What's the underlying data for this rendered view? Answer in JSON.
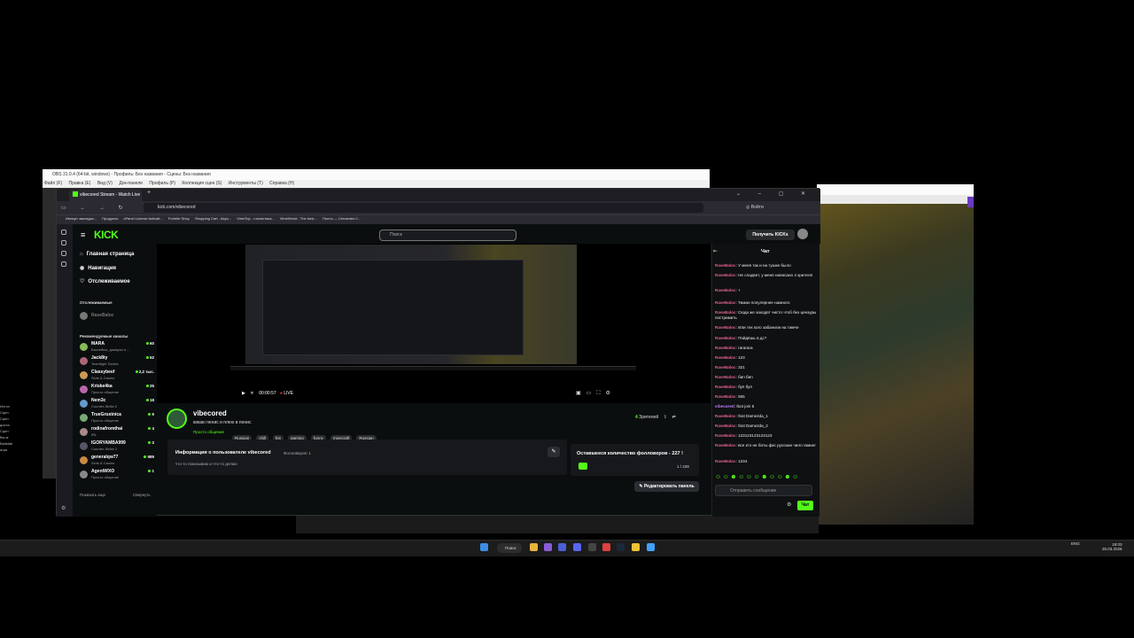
{
  "obs": {
    "title": "OBS 31.0.4 (64-bit, windows) - Профиль: Без названия - Сцены: Без названия",
    "menu": [
      "Файл (F)",
      "Правка (E)",
      "Вид (V)",
      "Док-панели",
      "Профиль (P)",
      "Коллекция сцен (S)",
      "Инструменты (T)",
      "Справка (H)"
    ],
    "side_texts": [
      "Источ",
      "Сцен",
      "Сцен",
      "доста",
      "Сцен",
      "Вы м",
      "Ballstab",
      "игра"
    ]
  },
  "browser": {
    "tab_title": "vibecored Stream - Watch Live",
    "url": "kick.com/vibecored",
    "bookmarks": [
      "Импорт закладок...",
      "Продукты",
      "cPanel License Activati...",
      "Fortnite Shop",
      "Shopping Cart - Akyo...",
      "VimeTop - статистика...",
      "VimeWorld - The best...",
      "Посты — Cervantes C..."
    ],
    "profile_label": "Войти"
  },
  "kick": {
    "logo": "KICK",
    "search_placeholder": "Поиск",
    "get_kicks": "Получить KICKs",
    "nav": [
      {
        "label": "Главная страница",
        "icon": "home-icon"
      },
      {
        "label": "Навигация",
        "icon": "compass-icon"
      },
      {
        "label": "Отслеживаемое",
        "icon": "heart-icon"
      }
    ],
    "followed_header": "Отслеживаемые",
    "followed_user": "RaseBaloc",
    "recommended_header": "Рекомендуемые каналы",
    "channels": [
      {
        "name": "MARA",
        "category": "Бассейны, джакузи и ...",
        "viewers": "60"
      },
      {
        "name": "Jack8ty",
        "category": "Teamfight Tactics",
        "viewers": "52"
      },
      {
        "name": "Classybeef",
        "category": "Slots & Casino",
        "viewers": "2,2 тыс."
      },
      {
        "name": "Kriske4ka",
        "category": "Просто общение",
        "viewers": "25"
      },
      {
        "name": "Nem3c",
        "category": "Counter-Strike 2",
        "viewers": "18"
      },
      {
        "name": "TrueGrustnica",
        "category": "Просто общение",
        "viewers": "9"
      },
      {
        "name": "rodinafromthai",
        "category": "IRL",
        "viewers": "4"
      },
      {
        "name": "IGORYAMBA999",
        "category": "Counter-Strike 2",
        "viewers": "3"
      },
      {
        "name": "generalqw77",
        "category": "Slots & Casino",
        "viewers": "989"
      },
      {
        "name": "AgentWXO",
        "category": "Просто общение",
        "viewers": "1"
      }
    ],
    "show_more": "Показать еще",
    "collapse": "Свернуть",
    "player": {
      "time": "00:00:57",
      "live": "LIVE"
    },
    "channel": {
      "name": "vibecored",
      "title": "кикаю пенис и плею в пенис",
      "category": "Просто общение",
      "tags": [
        "Russian",
        "chill",
        "fps",
        "gaming",
        "funny",
        "minecraft",
        "Russian"
      ],
      "viewers": "4",
      "viewers_label": "Зрителей"
    },
    "about": {
      "title": "Информация о пользователе vibecored",
      "followers_label": "Фолловеров:",
      "followers": "1",
      "text": "что-то показываю и что-то делаю"
    },
    "goal": {
      "title": "Оставшееся количество фолловеров - 227 !",
      "progress": "1 / 228"
    },
    "edit_panel": "Редактировать панель",
    "chat": {
      "header": "Чат",
      "messages": [
        {
          "user": "RaseBaloc",
          "text": "У меня так и на тушке было"
        },
        {
          "user": "RaseBaloc",
          "text": "Не сладвет, у меня написано 4 зрителя"
        },
        {
          "user": "RaseBaloc",
          "text": "+"
        },
        {
          "user": "RaseBaloc",
          "text": "Тиман популярнее намного"
        },
        {
          "user": "RaseBaloc",
          "text": "Сюда же заходят чисто чтоб без цензуры постримить"
        },
        {
          "user": "RaseBaloc",
          "text": "Или тех кого забанили на тимче"
        },
        {
          "user": "RaseBaloc",
          "text": "Пойдёшь в дс?"
        },
        {
          "user": "RaseBaloc",
          "text": "гагагага"
        },
        {
          "user": "RaseBaloc",
          "text": "123"
        },
        {
          "user": "RaseBaloc",
          "text": "321"
        },
        {
          "user": "RaseBaloc",
          "text": "бип бип"
        },
        {
          "user": "RaseBaloc",
          "text": "буп буп"
        },
        {
          "user": "RaseBaloc",
          "text": "555"
        },
        {
          "user": "vibecored",
          "text": "!bot join 5"
        },
        {
          "user": "RaseBaloc",
          "text": "!bot Damezda_1"
        },
        {
          "user": "RaseBaloc",
          "text": "!bot Damezda_2"
        },
        {
          "user": "RaseBaloc",
          "text": "123123123123123"
        },
        {
          "user": "RaseBaloc",
          "text": "все кто не боты фкс руссиан чилл гаминг"
        },
        {
          "user": "RaseBaloc",
          "text": "1234"
        }
      ],
      "input_placeholder": "Отправить сообщение",
      "send": "Чат"
    }
  },
  "taskbar": {
    "search": "Поиск",
    "lang": "ENG",
    "time": "18:03",
    "date": "25.03.2026"
  },
  "colors": {
    "accent": "#53fc18",
    "chat_user": "#e0638c"
  }
}
